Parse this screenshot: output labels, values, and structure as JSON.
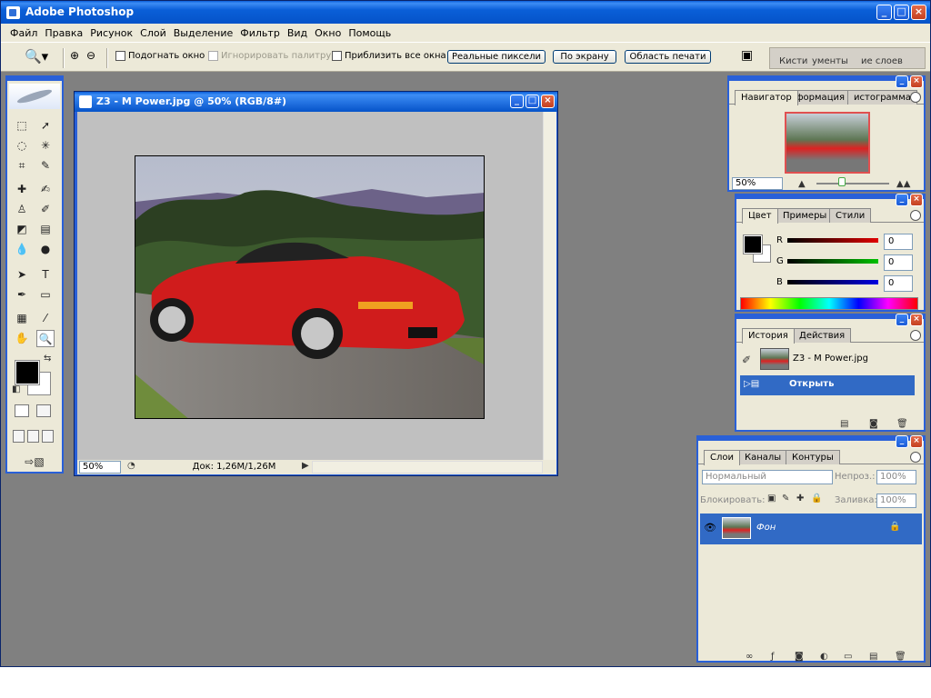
{
  "app": {
    "title": "Adobe Photoshop",
    "menu": [
      "Файл",
      "Правка",
      "Рисунок",
      "Слой",
      "Выделение",
      "Фильтр",
      "Вид",
      "Окно",
      "Помощь"
    ]
  },
  "options_bar": {
    "fit_window": "Подогнать окно",
    "ignore_palettes": "Игнорировать палитру",
    "zoom_all": "Приблизить все окна",
    "actual_pixels": "Реальные пиксели",
    "fit_screen": "По экрану",
    "print_size": "Область печати",
    "palette_well_tabs": [
      "Кисти",
      "ументы",
      "ие слоев"
    ]
  },
  "document": {
    "title": "Z3 - M Power.jpg @ 50% (RGB/8#)",
    "zoom": "50%",
    "doc_info": "Док: 1,26M/1,26M"
  },
  "navigator": {
    "tabs": [
      "Навигатор",
      "формация",
      "истограмма"
    ],
    "zoom": "50%",
    "zoom_slider": 0.35
  },
  "color": {
    "tabs": [
      "Цвет",
      "Примеры",
      "Стили"
    ],
    "channels": [
      {
        "label": "R",
        "value": "0",
        "color": "#e00000"
      },
      {
        "label": "G",
        "value": "0",
        "color": "#00c000"
      },
      {
        "label": "B",
        "value": "0",
        "color": "#0000e0"
      }
    ],
    "foreground": "#000000",
    "background": "#ffffff"
  },
  "history": {
    "tabs": [
      "История",
      "Действия"
    ],
    "snapshot": "Z3 - M Power.jpg",
    "states": [
      "Открыть"
    ]
  },
  "layers": {
    "tabs": [
      "Слои",
      "Каналы",
      "Контуры"
    ],
    "blend_mode": "Нормальный",
    "opacity_label": "Непроз.:",
    "opacity": "100%",
    "lock_label": "Блокировать:",
    "fill_label": "Заливка:",
    "fill": "100%",
    "items": [
      {
        "name": "Фон"
      }
    ]
  }
}
